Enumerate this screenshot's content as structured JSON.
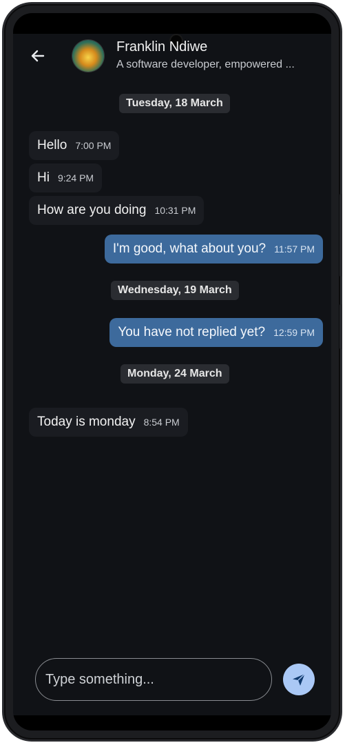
{
  "header": {
    "back_icon": "arrow-left-icon",
    "contact_name": "Franklin Ndiwe",
    "contact_status": "A software developer, empowered ..."
  },
  "conversation": {
    "date_separators": [
      "Tuesday, 18 March",
      "Wednesday, 19 March",
      "Monday, 24 March"
    ],
    "messages": [
      {
        "text": "Hello",
        "time": "7:00 PM",
        "direction": "incoming"
      },
      {
        "text": "Hi",
        "time": "9:24 PM",
        "direction": "incoming"
      },
      {
        "text": "How are you doing",
        "time": "10:31 PM",
        "direction": "incoming"
      },
      {
        "text": "I'm good, what about you?",
        "time": "11:57 PM",
        "direction": "outgoing"
      },
      {
        "text": "You have not replied yet?",
        "time": "12:59 PM",
        "direction": "outgoing"
      },
      {
        "text": "Today is monday",
        "time": "8:54 PM",
        "direction": "incoming"
      }
    ]
  },
  "composer": {
    "placeholder": "Type something...",
    "value": "",
    "send_icon": "send-icon"
  },
  "colors": {
    "background": "#101216",
    "incoming_bubble": "#1a1c21",
    "outgoing_bubble": "#3d6a9c",
    "send_button": "#aac8f5"
  }
}
